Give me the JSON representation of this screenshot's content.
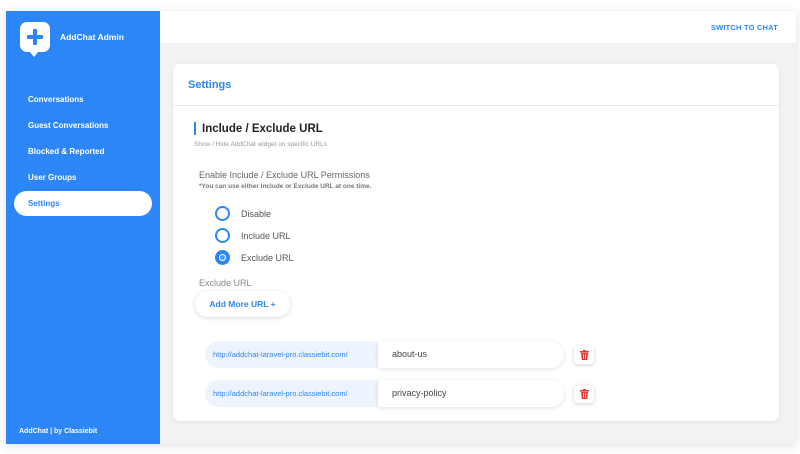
{
  "app": {
    "title": "AddChat Admin"
  },
  "sidebar": {
    "items": [
      {
        "label": "Conversations"
      },
      {
        "label": "Guest Conversations"
      },
      {
        "label": "Blocked & Reported"
      },
      {
        "label": "User Groups"
      },
      {
        "label": "Settings",
        "active": true
      }
    ],
    "footer": "AddChat | by Classiebit"
  },
  "topbar": {
    "switch_label": "SWITCH TO CHAT"
  },
  "settings": {
    "title": "Settings",
    "section_title": "Include / Exclude URL",
    "section_subtitle": "Show / Hide AddChat widget on specific URLs",
    "permissions_label": "Enable Include / Exclude URL Permissions",
    "permissions_note": "*You can use either Include or Exclude URL at one time.",
    "options": [
      {
        "label": "Disable",
        "checked": false
      },
      {
        "label": "Include URL",
        "checked": false
      },
      {
        "label": "Exclude URL",
        "checked": true
      }
    ],
    "exclude_label": "Exclude URL",
    "add_button": "Add More URL +",
    "urls": [
      {
        "prefix": "http://addchat-laravel-pro.classiebit.com/",
        "value": "about-us"
      },
      {
        "prefix": "http://addchat-laravel-pro.classiebit.com/",
        "value": "privacy-policy"
      }
    ]
  },
  "colors": {
    "accent": "#2d86f5",
    "danger": "#e53935",
    "background": "#f1f2f4"
  },
  "icons": {
    "logo": "chat-plus-icon",
    "delete": "trash-icon"
  }
}
